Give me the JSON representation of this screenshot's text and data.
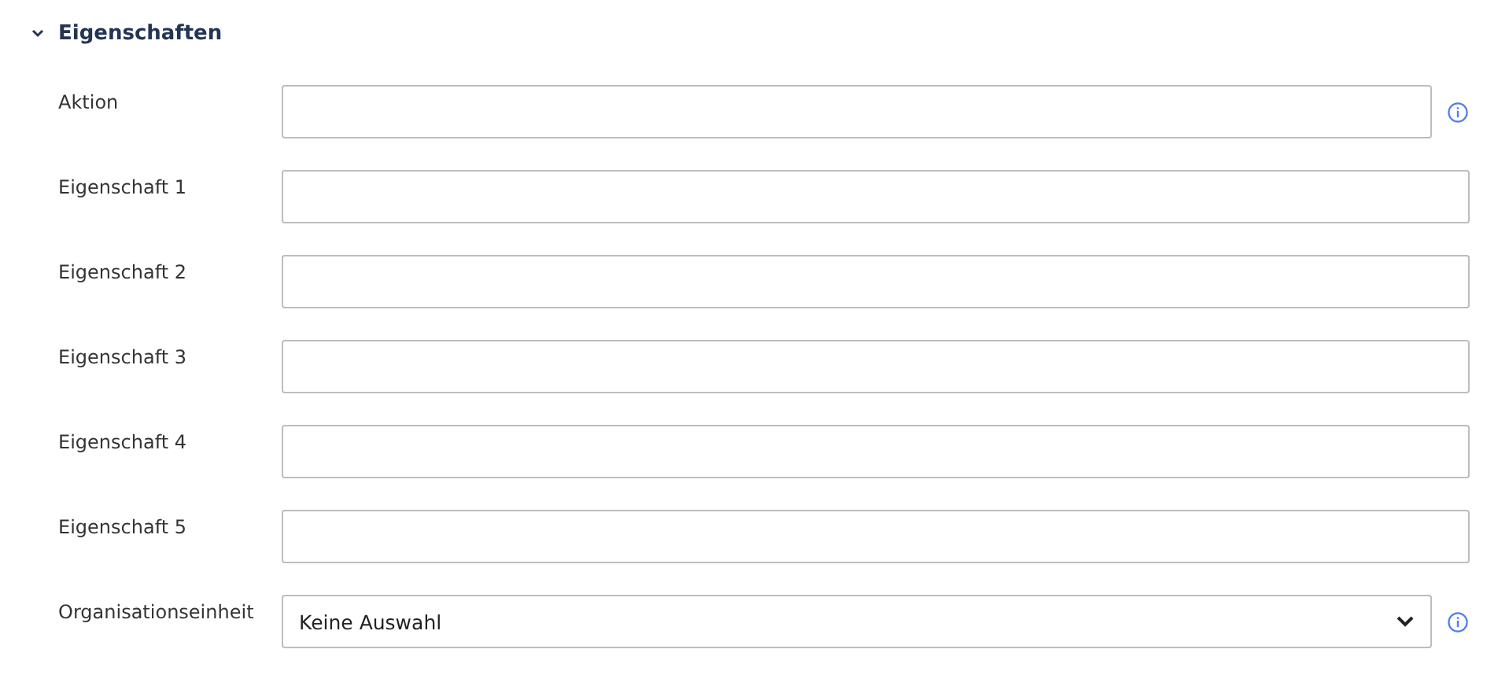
{
  "section": {
    "title": "Eigenschaften",
    "expanded": true
  },
  "fields": [
    {
      "label": "Aktion",
      "kind": "text",
      "info": true
    },
    {
      "label": "Eigenschaft 1",
      "kind": "text",
      "info": false
    },
    {
      "label": "Eigenschaft 2",
      "kind": "text",
      "info": false
    },
    {
      "label": "Eigenschaft 3",
      "kind": "text",
      "info": false
    },
    {
      "label": "Eigenschaft 4",
      "kind": "text",
      "info": false
    },
    {
      "label": "Eigenschaft 5",
      "kind": "text",
      "info": false
    },
    {
      "label": "Organisationseinheit",
      "kind": "select",
      "value": "Keine Auswahl",
      "info": true
    }
  ]
}
